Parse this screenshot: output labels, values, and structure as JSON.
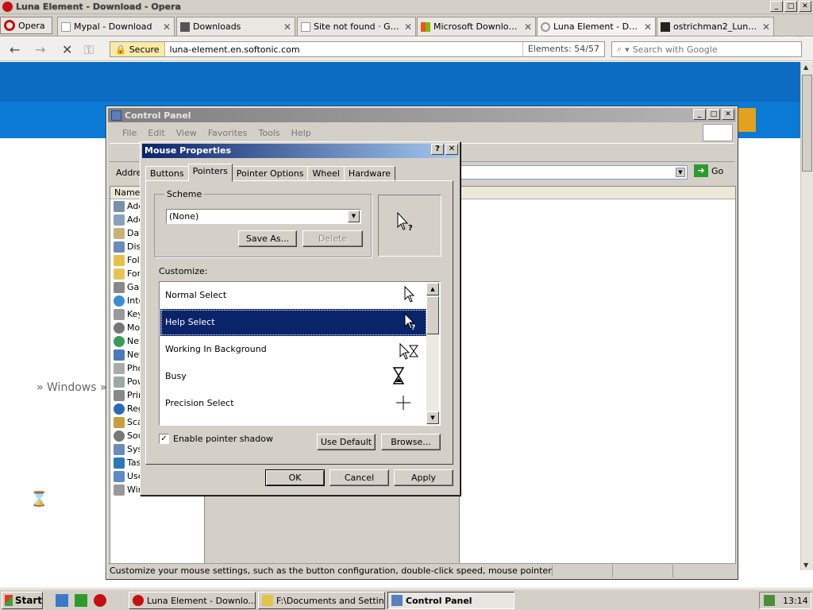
{
  "opera": {
    "title": "Luna Element - Download - Opera",
    "menu_label": "Opera",
    "tabs": [
      {
        "label": "Mypal - Download"
      },
      {
        "label": "Downloads"
      },
      {
        "label": "Site not found · Git..."
      },
      {
        "label": "Microsoft Download ..."
      },
      {
        "label": "Luna Element - Dow..."
      },
      {
        "label": "ostrichman2_Luna d..."
      }
    ],
    "secure_label": "Secure",
    "url": "luna-element.en.softonic.com",
    "elements_label": "Elements:",
    "elements_count": "54/57",
    "search_placeholder": "Search with Google"
  },
  "page": {
    "windows_link": "» Windows »"
  },
  "control_panel": {
    "title": "Control Panel",
    "menu": [
      "File",
      "Edit",
      "View",
      "Favorites",
      "Tools",
      "Help"
    ],
    "address_label": "Addre",
    "go_label": "Go",
    "list_header": "Name",
    "items": [
      "Add",
      "Add",
      "Dat",
      "Disp",
      "Fold",
      "Fon",
      "Gan",
      "Inte",
      "Key",
      "Mou",
      "Net",
      "Net",
      "Pho",
      "Pow",
      "Prin",
      "Reg",
      "Sca",
      "Sou",
      "Sys",
      "Tas",
      "Use",
      "Wir"
    ],
    "status_text": "Customize your mouse settings, such as the button configuration, double-click speed, mouse pointers, and motion sp"
  },
  "mouse_properties": {
    "title": "Mouse Properties",
    "help_btn": "?",
    "close_btn": "✕",
    "tabs": [
      "Buttons",
      "Pointers",
      "Pointer Options",
      "Wheel",
      "Hardware"
    ],
    "scheme_label": "Scheme",
    "scheme_value": "(None)",
    "save_as": "Save As...",
    "delete": "Delete",
    "customize_label": "Customize:",
    "pointers": [
      {
        "name": "Normal Select"
      },
      {
        "name": "Help Select"
      },
      {
        "name": "Working In Background"
      },
      {
        "name": "Busy"
      },
      {
        "name": "Precision Select"
      }
    ],
    "shadow_label": "Enable pointer shadow",
    "shadow_checked": true,
    "use_default": "Use Default",
    "browse": "Browse...",
    "ok": "OK",
    "cancel": "Cancel",
    "apply": "Apply"
  },
  "taskbar": {
    "start": "Start",
    "tasks": [
      {
        "label": "Luna Element - Downlo..."
      },
      {
        "label": "F:\\Documents and Settin..."
      },
      {
        "label": "Control Panel"
      }
    ],
    "clock": "13:14"
  }
}
